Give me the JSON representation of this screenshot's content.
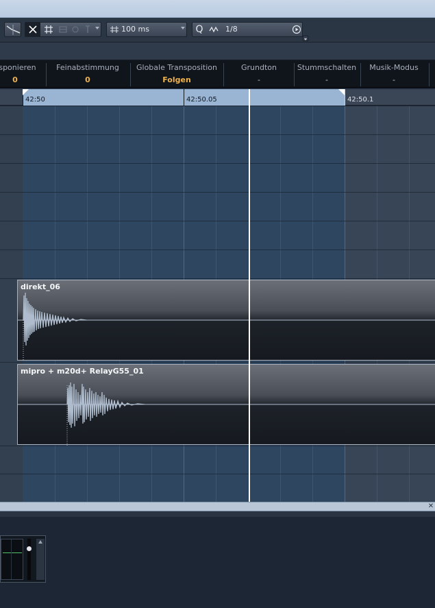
{
  "toolbar": {
    "snap_time": "100 ms",
    "quantize_value": "1/8",
    "icons": [
      "snap-type-icon",
      "snap-toggle-icon",
      "grid-icon",
      "quantize-q-icon",
      "wave-quantize-icon",
      "play-icon"
    ]
  },
  "infoline": {
    "columns": [
      {
        "label": "nsponieren",
        "value": "0",
        "accent": true
      },
      {
        "label": "Feinabstimmung",
        "value": "0",
        "accent": true
      },
      {
        "label": "Globale Transposition",
        "value": "Folgen",
        "accent": true
      },
      {
        "label": "Grundton",
        "value": "-",
        "accent": false
      },
      {
        "label": "Stummschalten",
        "value": "-",
        "accent": false
      },
      {
        "label": "Musik-Modus",
        "value": "-",
        "accent": false
      }
    ]
  },
  "ruler": {
    "labels": [
      "42:50",
      "42:50.05",
      "42:50.1"
    ]
  },
  "events": [
    {
      "name": "direkt_06"
    },
    {
      "name": "mipro + m20d+ RelayG55_01"
    }
  ],
  "colors": {
    "accent": "#f0b24a",
    "selection": "#9ab4d4",
    "cursor": "#ffffff",
    "waveform": "#aebccd"
  }
}
